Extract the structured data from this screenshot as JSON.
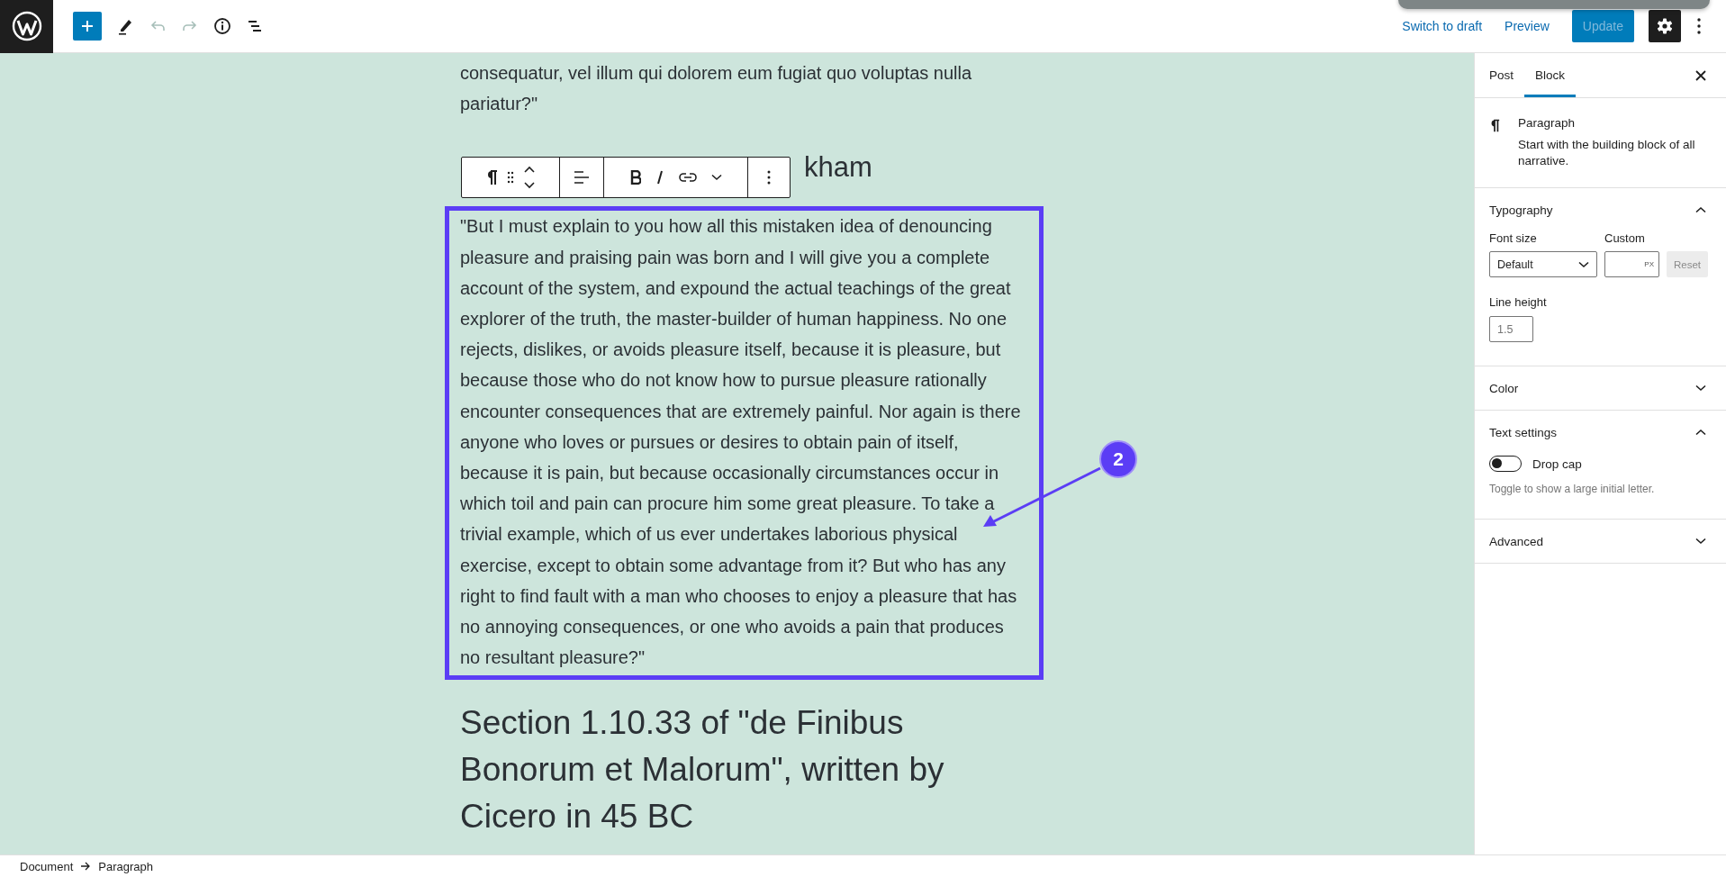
{
  "top_bar": {
    "undo": {
      "disabled": true
    },
    "redo": {
      "disabled": true
    },
    "switch_to_draft": "Switch to draft",
    "preview": "Preview",
    "update": {
      "label": "Update",
      "disabled": true
    },
    "settings": {
      "selected": true
    }
  },
  "editor": {
    "intro_paragraph": "consequatur, vel illum qui dolorem eum fugiat quo voluptas nulla pariatur?\"",
    "covered_heading": "kham",
    "selected_paragraph": {
      "text": "\"But I must explain to you how all this mistaken idea of denouncing pleasure and praising pain was born and I will give you a complete account of the system, and expound the actual teachings of the great explorer of the truth, the master-builder of human happiness. No one rejects, dislikes, or avoids pleasure itself, because it is pleasure, but because those who do not know how to pursue pleasure rationally encounter consequences that are extremely painful. Nor again is there anyone who loves or pursues or desires to obtain pain of itself, because it is pain, but because occasionally circumstances occur in which toil and pain can procure him some great pleasure. To take a trivial example, which of us ever undertakes laborious physical exercise, except to obtain some advantage from it? But who has any right to find fault with a man who chooses to enjoy a pleasure that has no annoying consequences, or one who avoids a pain that produces no resultant pleasure?\"",
      "highlighted": true
    },
    "next_heading": "Section 1.10.33 of \"de Finibus Bonorum et Malorum\", written by Cicero in 45 BC",
    "annotation": {
      "label": "2"
    }
  },
  "sidebar": {
    "tabs": [
      {
        "label": "Post",
        "selected": false
      },
      {
        "label": "Block",
        "selected": true
      }
    ],
    "block_card": {
      "title": "Paragraph",
      "description": "Start with the building block of all narrative."
    },
    "panels": [
      {
        "kind": "typography",
        "title": "Typography",
        "expanded": true,
        "font_size": {
          "label": "Font size",
          "value": "Default"
        },
        "custom": {
          "label": "Custom",
          "unit": "PX"
        },
        "reset": {
          "label": "Reset",
          "disabled": true
        },
        "line_height": {
          "label": "Line height",
          "placeholder": "1.5"
        }
      },
      {
        "title": "Color",
        "expanded": false
      },
      {
        "kind": "text_settings",
        "title": "Text settings",
        "expanded": true,
        "toggle": {
          "label": "Drop cap",
          "on": false
        },
        "help": "Toggle to show a large initial letter."
      },
      {
        "title": "Advanced",
        "expanded": false
      }
    ]
  },
  "breadcrumbs": [
    "Document",
    "Paragraph"
  ]
}
